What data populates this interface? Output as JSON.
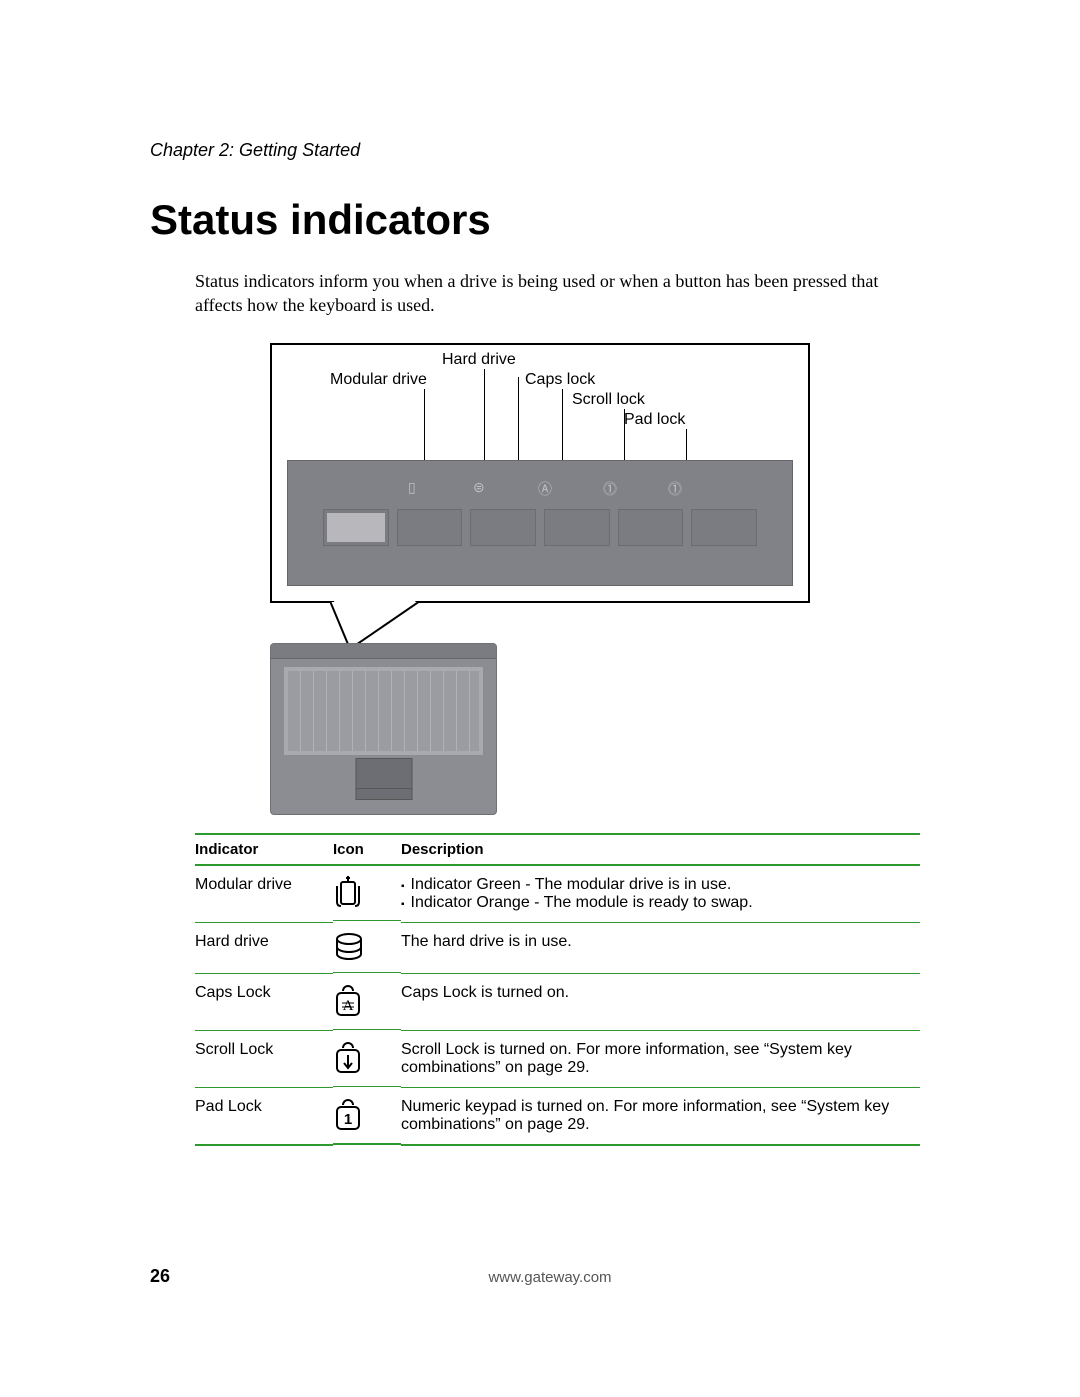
{
  "chapter": "Chapter 2: Getting Started",
  "title": "Status indicators",
  "intro": "Status indicators inform you when a drive is being used or when a button has been pressed that affects how the keyboard is used.",
  "diagram": {
    "labels": {
      "hardDrive": "Hard drive",
      "modularDrive": "Modular drive",
      "capsLock": "Caps lock",
      "scrollLock": "Scroll lock",
      "padLock": "Pad lock"
    }
  },
  "table": {
    "headers": {
      "indicator": "Indicator",
      "icon": "Icon",
      "description": "Description"
    },
    "rows": [
      {
        "indicator": "Modular drive",
        "icon": "modular-drive-icon",
        "descList": [
          "Indicator Green - The modular drive is in use.",
          "Indicator Orange - The module is ready to swap."
        ]
      },
      {
        "indicator": "Hard drive",
        "icon": "hard-drive-icon",
        "desc": "The hard drive is in use."
      },
      {
        "indicator": "Caps Lock",
        "icon": "caps-lock-icon",
        "desc": "Caps Lock is turned on."
      },
      {
        "indicator": "Scroll Lock",
        "icon": "scroll-lock-icon",
        "desc": "Scroll Lock is turned on. For more information, see “System key combinations” on page 29."
      },
      {
        "indicator": "Pad Lock",
        "icon": "pad-lock-icon",
        "desc": "Numeric keypad is turned on. For more information, see “System key combinations” on page 29."
      }
    ]
  },
  "footer": {
    "page": "26",
    "url": "www.gateway.com"
  }
}
